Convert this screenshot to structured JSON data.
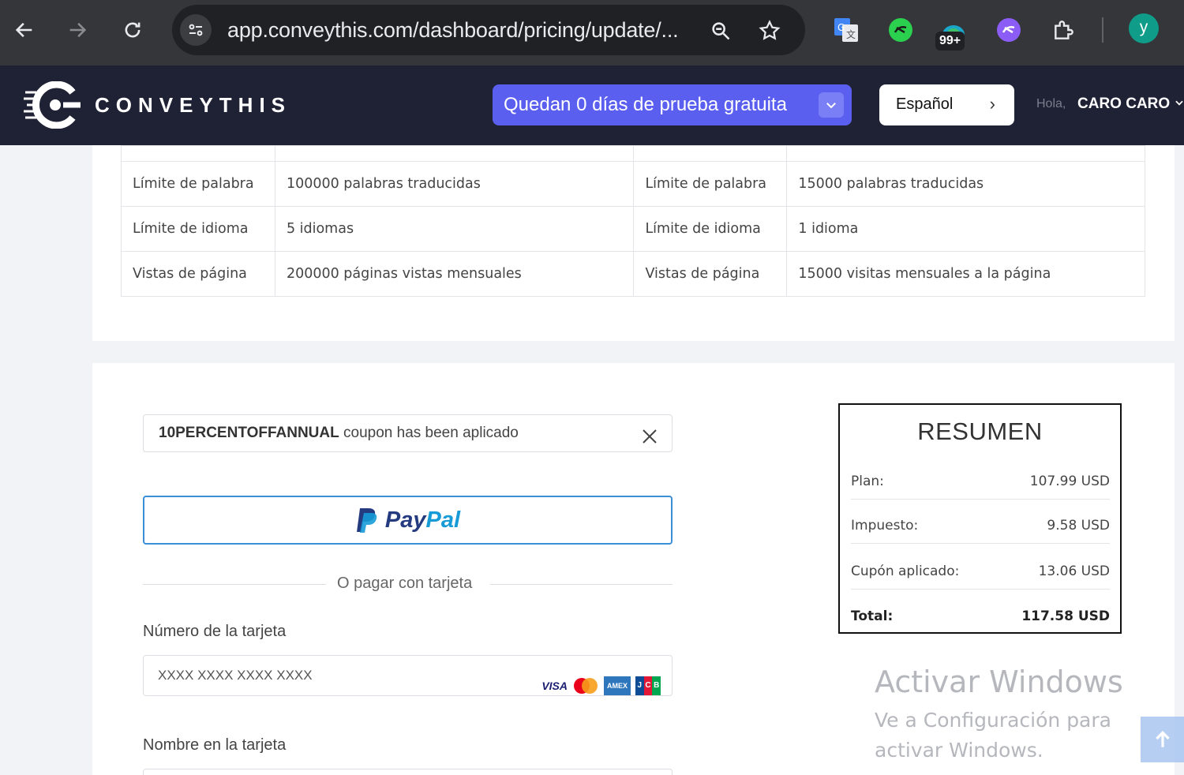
{
  "browser": {
    "url": "app.conveythis.com/dashboard/pricing/update/...",
    "extension_badge": "99+",
    "profile_initial": "y"
  },
  "header": {
    "logo_text": "CONVEYTHIS",
    "trial_banner": "Quedan 0 días de prueba gratuita",
    "language": "Español",
    "greeting": "Hola,",
    "user_name": "CARO CARO"
  },
  "comparison": {
    "rows": [
      {
        "label_a": "Límite de palabra",
        "value_a": "100000 palabras traducidas",
        "label_b": "Límite de palabra",
        "value_b": "15000 palabras traducidas"
      },
      {
        "label_a": "Límite de idioma",
        "value_a": "5 idiomas",
        "label_b": "Límite de idioma",
        "value_b": "1 idioma"
      },
      {
        "label_a": "Vistas de página",
        "value_a": "200000 páginas vistas mensuales",
        "label_b": "Vistas de página",
        "value_b": "15000 visitas mensuales a la página"
      }
    ]
  },
  "payment": {
    "coupon_code": "10PERCENTOFFANNUAL",
    "coupon_message": " coupon has been aplicado",
    "paypal_pay": "Pay",
    "paypal_pal": "Pal",
    "or_text": "O pagar con tarjeta",
    "card_number_label": "Número de la tarjeta",
    "card_number_placeholder": "XXXX XXXX XXXX XXXX",
    "card_name_label": "Nombre en la tarjeta",
    "card_brands": [
      "VISA",
      "Mastercard",
      "AMEX",
      "JCB"
    ]
  },
  "summary": {
    "title": "RESUMEN",
    "rows": [
      {
        "label": "Plan:",
        "value": "107.99 USD"
      },
      {
        "label": "Impuesto:",
        "value": "9.58 USD"
      },
      {
        "label": "Cupón aplicado:",
        "value": "13.06 USD"
      },
      {
        "label": "Total:",
        "value": "117.58 USD"
      }
    ]
  },
  "watermark": {
    "title": "Activar Windows",
    "subtitle": "Ve a Configuración para activar Windows."
  },
  "colors": {
    "header_bg": "#1f2234",
    "trial_purple": "#5b5fef",
    "paypal_border": "#3b8fd6"
  }
}
